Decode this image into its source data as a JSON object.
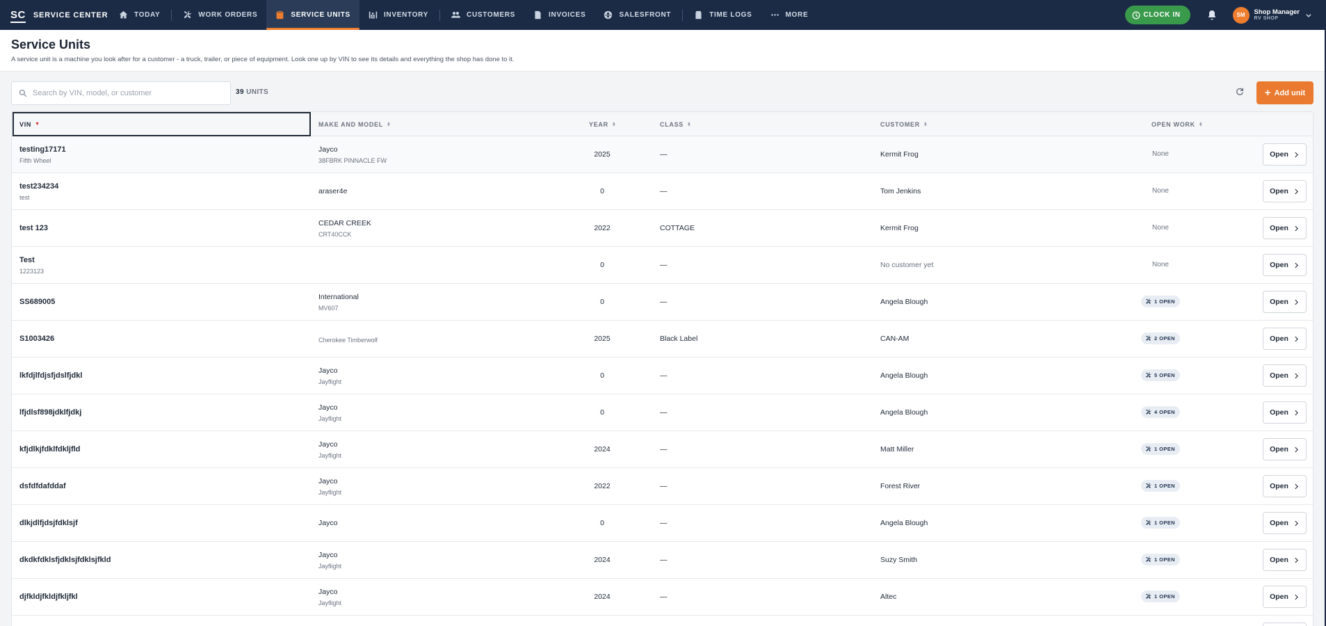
{
  "app": {
    "logo": "SC",
    "name": "SERVICE CENTER"
  },
  "nav": {
    "today": "TODAY",
    "work_orders": "WORK ORDERS",
    "service_units": "SERVICE UNITS",
    "inventory": "INVENTORY",
    "customers": "CUSTOMERS",
    "invoices": "INVOICES",
    "salesfront": "SALESFRONT",
    "time_logs": "TIME LOGS",
    "more": "MORE"
  },
  "header_right": {
    "clock_in": "CLOCK IN",
    "avatar_initials": "SM",
    "user_name": "Shop Manager",
    "user_shop": "RV SHOP"
  },
  "page": {
    "title": "Service Units",
    "description": "A service unit is a machine you look after for a customer - a truck, trailer, or piece of equipment. Look one up by VIN to see its details and everything the shop has done to it."
  },
  "toolbar": {
    "search_placeholder": "Search by VIN, model, or customer",
    "unit_count": "39",
    "unit_label": "UNITS",
    "add_label": "Add unit"
  },
  "table": {
    "headers": {
      "vin": "VIN",
      "make_model": "MAKE AND MODEL",
      "year": "YEAR",
      "class": "CLASS",
      "customer": "CUSTOMER",
      "open_work": "OPEN WORK"
    },
    "open_label": "Open",
    "rows": [
      {
        "vin": "testing17171",
        "vin_sub": "Fifth Wheel",
        "make": "Jayco",
        "model": "38FBRK PINNACLE FW",
        "year": "2025",
        "class": "—",
        "customer": "Kermit Frog",
        "work": "None"
      },
      {
        "vin": "test234234",
        "vin_sub": "test",
        "make": "araser4e",
        "model": "",
        "year": "0",
        "class": "—",
        "customer": "Tom Jenkins",
        "work": "None"
      },
      {
        "vin": "test 123",
        "vin_sub": "",
        "make": "CEDAR CREEK",
        "model": "CRT40CCK",
        "year": "2022",
        "class": "COTTAGE",
        "customer": "Kermit Frog",
        "work": "None"
      },
      {
        "vin": "Test",
        "vin_sub": "1223123",
        "make": "",
        "model": "",
        "year": "0",
        "class": "—",
        "customer": "No customer yet",
        "work": "None",
        "customer_empty": true
      },
      {
        "vin": "SS689005",
        "vin_sub": "",
        "make": "International",
        "model": "MV607",
        "year": "0",
        "class": "—",
        "customer": "Angela Blough",
        "work": "1 OPEN"
      },
      {
        "vin": "S1003426",
        "vin_sub": "",
        "make": "",
        "model": "Cherokee Timberwolf",
        "year": "2025",
        "class": "Black Label",
        "customer": "CAN-AM",
        "work": "2 OPEN"
      },
      {
        "vin": "lkfdjlfdjsfjdslfjdkl",
        "vin_sub": "",
        "make": "Jayco",
        "model": "Jayflight",
        "year": "0",
        "class": "—",
        "customer": "Angela Blough",
        "work": "5 OPEN"
      },
      {
        "vin": "lfjdlsf898jdklfjdkj",
        "vin_sub": "",
        "make": "Jayco",
        "model": "Jayflight",
        "year": "0",
        "class": "—",
        "customer": "Angela Blough",
        "work": "4 OPEN"
      },
      {
        "vin": "kfjdlkjfdklfdkljfld",
        "vin_sub": "",
        "make": "Jayco",
        "model": "Jayflight",
        "year": "2024",
        "class": "—",
        "customer": "Matt Miller",
        "work": "1 OPEN"
      },
      {
        "vin": "dsfdfdafddaf",
        "vin_sub": "",
        "make": "Jayco",
        "model": "Jayflight",
        "year": "2022",
        "class": "—",
        "customer": "Forest River",
        "work": "1 OPEN"
      },
      {
        "vin": "dlkjdlfjdsjfdklsjf",
        "vin_sub": "",
        "make": "Jayco",
        "model": "",
        "year": "0",
        "class": "—",
        "customer": "Angela Blough",
        "work": "1 OPEN"
      },
      {
        "vin": "dkdkfdklsfjdklsjfdklsjfkld",
        "vin_sub": "",
        "make": "Jayco",
        "model": "Jayflight",
        "year": "2024",
        "class": "—",
        "customer": "Suzy Smith",
        "work": "1 OPEN"
      },
      {
        "vin": "djfkldjfkldjfkljfkl",
        "vin_sub": "",
        "make": "Jayco",
        "model": "Jayflight",
        "year": "2024",
        "class": "—",
        "customer": "Altec",
        "work": "1 OPEN"
      },
      {
        "vin": "",
        "vin_sub": "",
        "make": "",
        "model": "",
        "year": "",
        "class": "",
        "customer": "",
        "work": ""
      }
    ]
  }
}
